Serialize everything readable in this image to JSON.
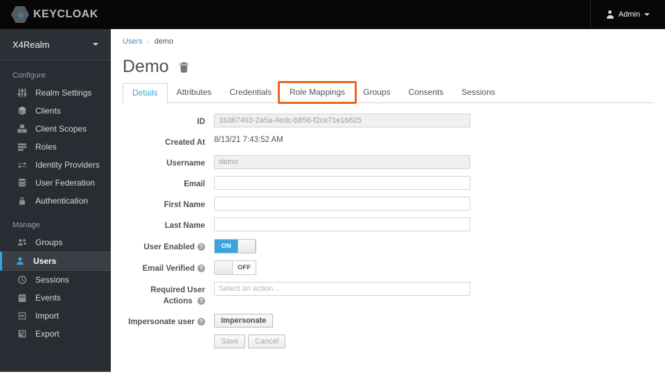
{
  "topbar": {
    "brand": "KEYCLOAK",
    "user_label": "Admin"
  },
  "icons": {
    "help": "?",
    "logo_left": "‹",
    "logo_right": "›"
  },
  "colors": {
    "accent_blue": "#39a5dc",
    "highlight_orange": "#e8671f",
    "link_blue": "#3a8cc7",
    "sidebar_bg": "#292d33",
    "topbar_bg": "#070707"
  },
  "sidebar": {
    "realm": "X4Realm",
    "sections": [
      {
        "label": "Configure",
        "items": [
          {
            "label": "Realm Settings",
            "icon": "sliders-icon"
          },
          {
            "label": "Clients",
            "icon": "cube-icon"
          },
          {
            "label": "Client Scopes",
            "icon": "cubes-icon"
          },
          {
            "label": "Roles",
            "icon": "list-icon"
          },
          {
            "label": "Identity Providers",
            "icon": "exchange-arrows-icon"
          },
          {
            "label": "User Federation",
            "icon": "database-icon"
          },
          {
            "label": "Authentication",
            "icon": "lock-icon"
          }
        ]
      },
      {
        "label": "Manage",
        "items": [
          {
            "label": "Groups",
            "icon": "group-icon"
          },
          {
            "label": "Users",
            "icon": "user-icon",
            "active": true
          },
          {
            "label": "Sessions",
            "icon": "clock-icon"
          },
          {
            "label": "Events",
            "icon": "calendar-icon"
          },
          {
            "label": "Import",
            "icon": "import-icon"
          },
          {
            "label": "Export",
            "icon": "export-icon"
          }
        ]
      }
    ]
  },
  "breadcrumb": {
    "items": [
      "Users",
      "demo"
    ],
    "separator": "›"
  },
  "page": {
    "title": "Demo"
  },
  "tabs": {
    "items": [
      {
        "label": "Details",
        "active": true
      },
      {
        "label": "Attributes"
      },
      {
        "label": "Credentials"
      },
      {
        "label": "Role Mappings",
        "highlighted": true
      },
      {
        "label": "Groups"
      },
      {
        "label": "Consents"
      },
      {
        "label": "Sessions"
      }
    ]
  },
  "form": {
    "id": {
      "label": "ID",
      "value": "1b367493-2a5a-4edc-b858-f2ce71e1b625"
    },
    "created_at": {
      "label": "Created At",
      "value": "8/13/21 7:43:52 AM"
    },
    "username": {
      "label": "Username",
      "value": "demo"
    },
    "email": {
      "label": "Email",
      "value": ""
    },
    "first_name": {
      "label": "First Name",
      "value": ""
    },
    "last_name": {
      "label": "Last Name",
      "value": ""
    },
    "user_enabled": {
      "label": "User Enabled",
      "state": "ON"
    },
    "email_verified": {
      "label": "Email Verified",
      "state": "OFF"
    },
    "required_actions": {
      "label": "Required User Actions",
      "placeholder": "Select an action..."
    },
    "impersonate": {
      "label": "Impersonate user",
      "button_label": "Impersonate"
    },
    "actions": {
      "save": "Save",
      "cancel": "Cancel"
    }
  }
}
